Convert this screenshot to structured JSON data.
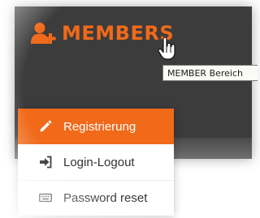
{
  "brand": {
    "label": "MEMBERS",
    "icon": "user-plus-icon",
    "color": "#f06a1a"
  },
  "tooltip": {
    "text": "MEMBER Bereich"
  },
  "menu": {
    "items": [
      {
        "label": "Registrierung",
        "icon": "pencil-icon",
        "active": true
      },
      {
        "label": "Login-Logout",
        "icon": "sign-in-icon",
        "active": false
      },
      {
        "label": "Password reset",
        "icon": "keyboard-icon",
        "active": false
      }
    ]
  },
  "colors": {
    "accent": "#f06a1a",
    "navbar": "#3c3c3c",
    "menu_bg": "#ffffff"
  }
}
